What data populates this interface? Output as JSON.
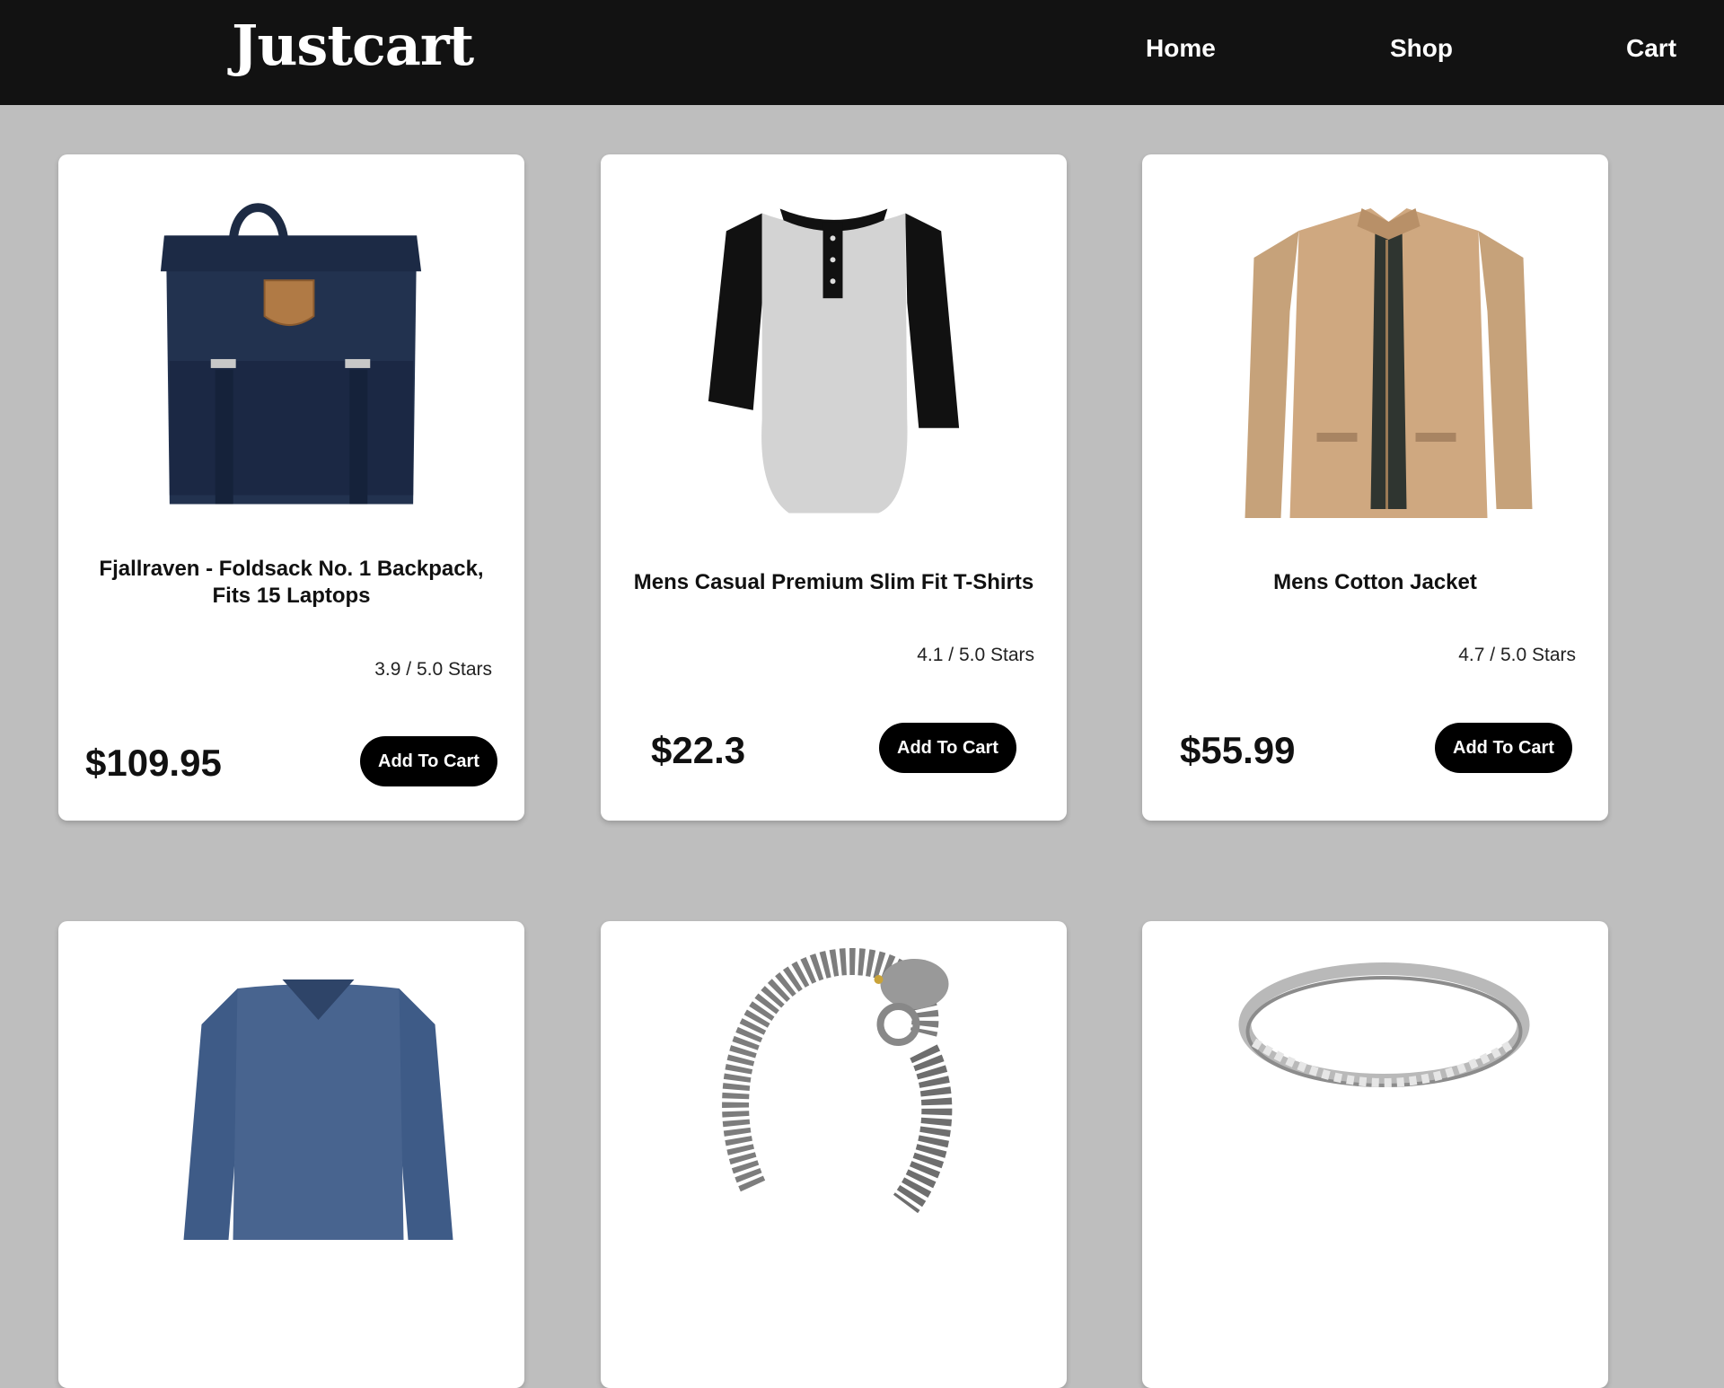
{
  "header": {
    "brand": "Justcart",
    "nav": [
      "Home",
      "Shop",
      "Cart"
    ]
  },
  "products": [
    {
      "title": "Fjallraven - Foldsack No. 1 Backpack, Fits 15 Laptops",
      "rating": "3.9 / 5.0 Stars",
      "price": "$109.95",
      "button": "Add To Cart",
      "icon": "backpack-image"
    },
    {
      "title": "Mens Casual Premium Slim Fit T-Shirts",
      "rating": "4.1 / 5.0 Stars",
      "price": "$22.3",
      "button": "Add To Cart",
      "icon": "tshirt-image"
    },
    {
      "title": "Mens Cotton Jacket",
      "rating": "4.7 / 5.0 Stars",
      "price": "$55.99",
      "button": "Add To Cart",
      "icon": "jacket-image"
    },
    {
      "icon": "long-sleeve-shirt-image"
    },
    {
      "icon": "dragon-bracelet-image"
    },
    {
      "icon": "silver-ring-image"
    }
  ],
  "colors": {
    "navbar": "#121212",
    "page_background": "#bebebe",
    "button": "#000000"
  }
}
